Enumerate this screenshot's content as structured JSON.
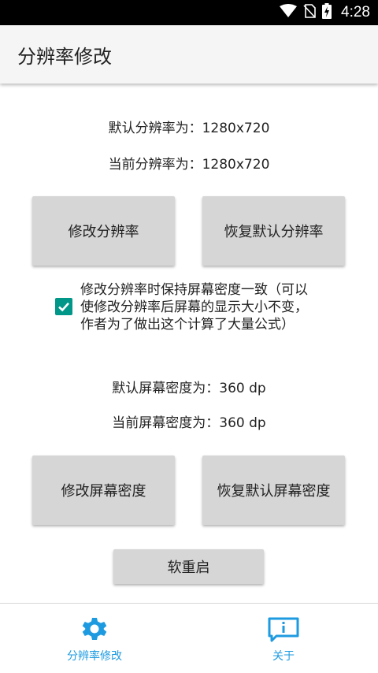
{
  "status_bar": {
    "time": "4:28"
  },
  "app_bar": {
    "title": "分辨率修改"
  },
  "resolution": {
    "default_text": "默认分辨率为：1280x720",
    "current_text": "当前分辨率为：1280x720",
    "modify_button": "修改分辨率",
    "restore_button": "恢复默认分辨率"
  },
  "keep_density": {
    "checked": true,
    "label_line1": "修改分辨率时保持屏幕密度一致（可以",
    "label_line2": "使修改分辨率后屏幕的显示大小不变，",
    "label_line3": "作者为了做出这个计算了大量公式）"
  },
  "density": {
    "default_text": "默认屏幕密度为：360 dp",
    "current_text": "当前屏幕密度为：360 dp",
    "modify_button": "修改屏幕密度",
    "restore_button": "恢复默认屏幕密度"
  },
  "soft_reboot_button": "软重启",
  "bottom_nav": {
    "items": [
      {
        "label": "分辨率修改",
        "icon": "gear-icon"
      },
      {
        "label": "关于",
        "icon": "info-icon"
      }
    ]
  },
  "colors": {
    "accent": "#009688",
    "nav_active": "#1e9be0",
    "button_bg": "#d6d6d6",
    "app_bar_bg": "#f5f5f5"
  }
}
